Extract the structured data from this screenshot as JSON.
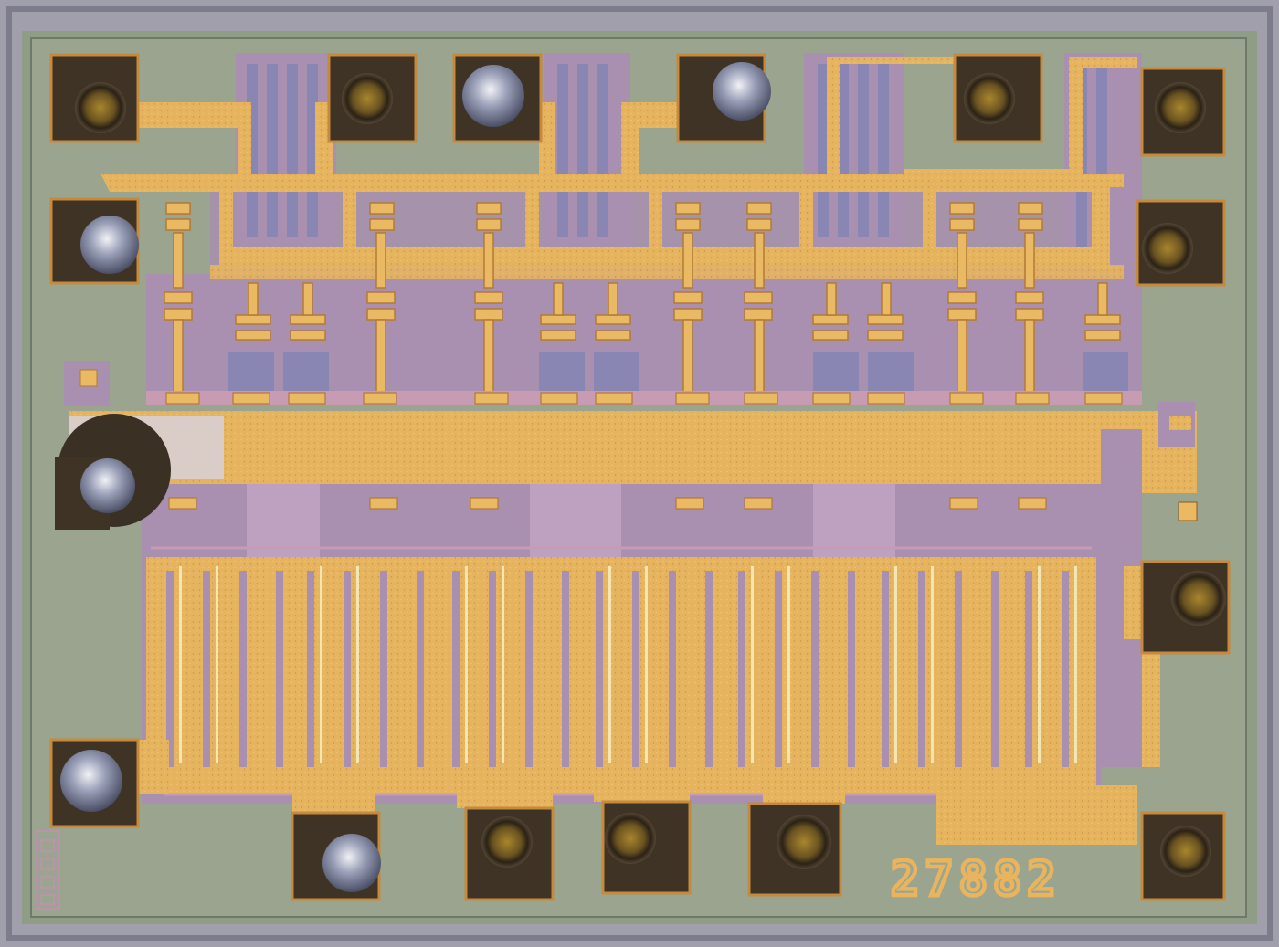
{
  "die": {
    "part_number": "27882"
  },
  "colors": {
    "frame": "#a19fac",
    "substrate": "#9aa48f",
    "metal": "#e6b45f",
    "metal_dark": "#cf9141",
    "oxide_purple": "#a98fb0",
    "diffusion_blue": "#8a86b4",
    "bond_pad": "#3e3324"
  }
}
